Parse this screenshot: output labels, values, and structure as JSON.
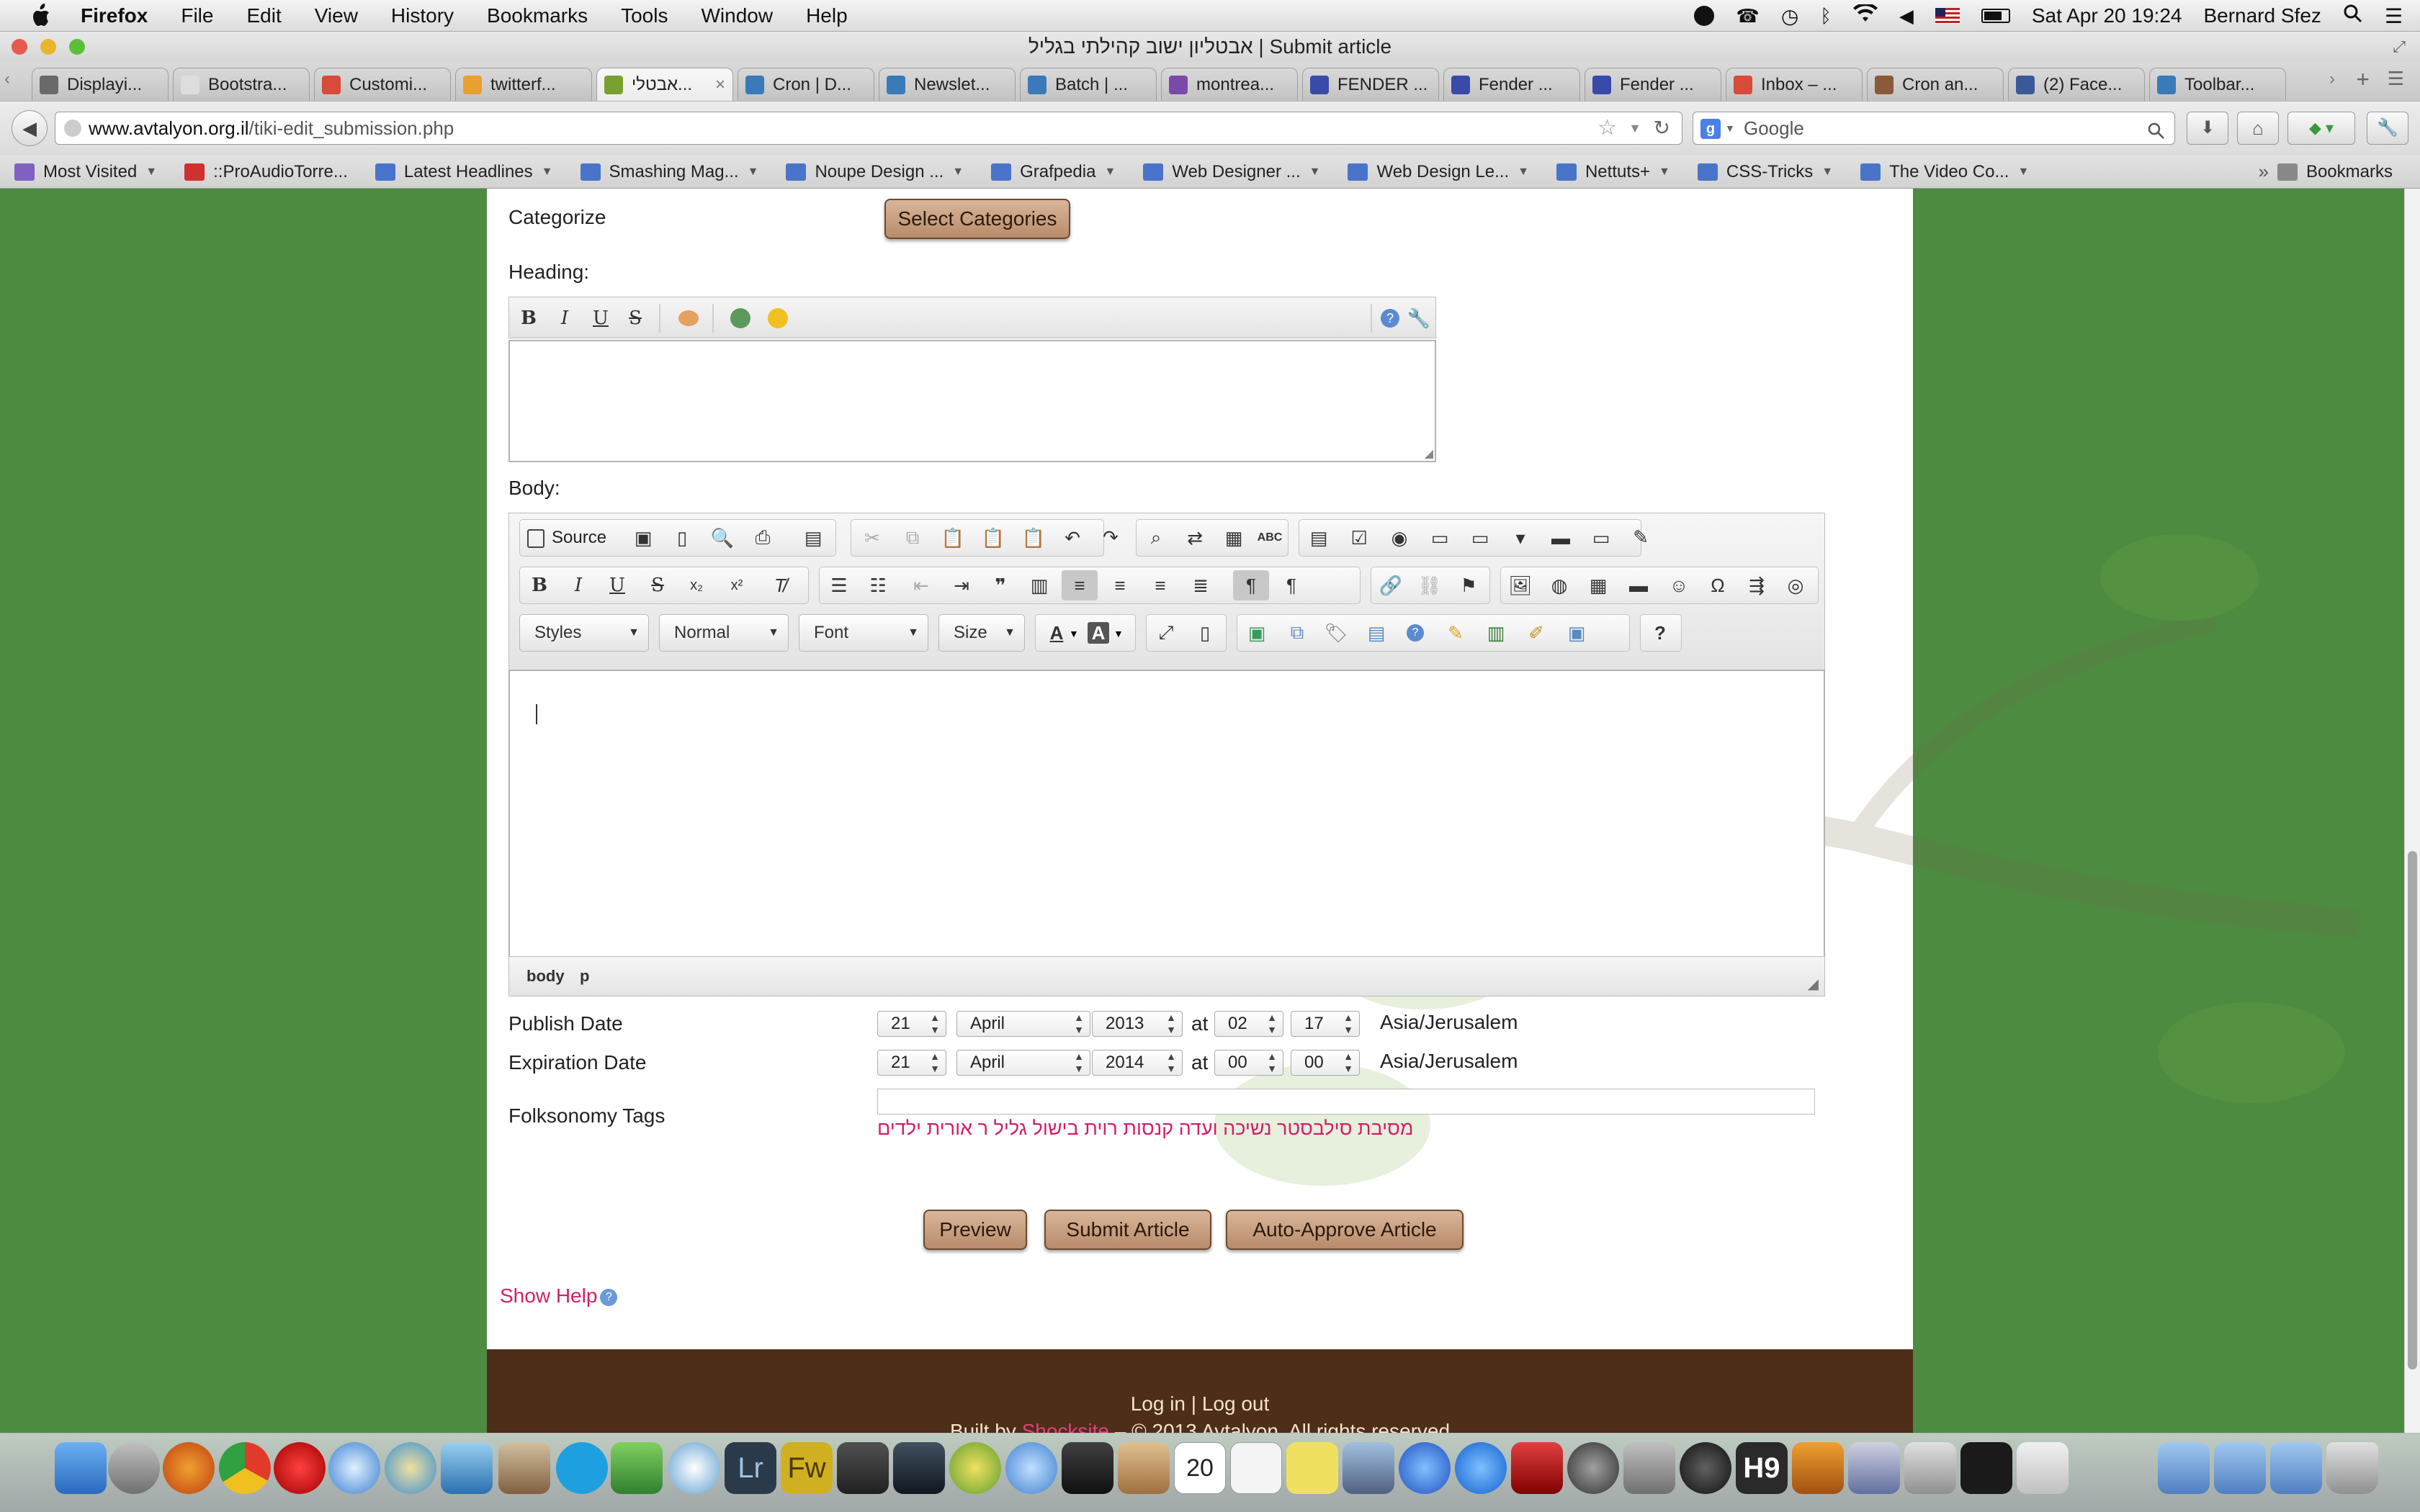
{
  "menubar": {
    "app": "Firefox",
    "items": [
      "File",
      "Edit",
      "View",
      "History",
      "Bookmarks",
      "Tools",
      "Window",
      "Help"
    ],
    "clock": "Sat Apr 20  19:24",
    "user": "Bernard Sfez"
  },
  "window": {
    "title": "אבטליון ישוב קהילתי בגליל | Submit article"
  },
  "tabs": [
    {
      "label": "Displayi...",
      "color": "#6a6a6a"
    },
    {
      "label": "Bootstra...",
      "color": "#dddddd"
    },
    {
      "label": "Customi...",
      "color": "#d84a3a"
    },
    {
      "label": "twitterf...",
      "color": "#e8a030"
    },
    {
      "label": "אבטלי...",
      "color": "#7aa030"
    },
    {
      "label": "Cron | D...",
      "color": "#3a7ab8"
    },
    {
      "label": "Newslet...",
      "color": "#3a7ab8"
    },
    {
      "label": "Batch | ...",
      "color": "#3a7ab8"
    },
    {
      "label": "montrea...",
      "color": "#7a4aa8"
    },
    {
      "label": "FENDER ...",
      "color": "#3a4aa8"
    },
    {
      "label": "Fender ...",
      "color": "#3a4aa8"
    },
    {
      "label": "Fender ...",
      "color": "#3a4aa8"
    },
    {
      "label": "Inbox – ...",
      "color": "#d84a3a"
    },
    {
      "label": "Cron an...",
      "color": "#8a5a3a"
    },
    {
      "label": "(2) Face...",
      "color": "#3b5998"
    },
    {
      "label": "Toolbar...",
      "color": "#3a7ab8"
    }
  ],
  "nav": {
    "url_domain": "www.avtalyon.org.il",
    "url_path": "/tiki-edit_submission.php",
    "search_placeholder": "Google"
  },
  "bookmarks": [
    "Most Visited",
    "::ProAudioTorre...",
    "Latest Headlines",
    "Smashing Mag...",
    "Noupe Design ...",
    "Grafpedia",
    "Web Designer ...",
    "Web Design Le...",
    "Nettuts+",
    "CSS-Tricks",
    "The Video Co...",
    "Bookmarks"
  ],
  "form": {
    "categorize_label": "Categorize",
    "select_categories_button": "Select Categories",
    "heading_label": "Heading:",
    "body_label": "Body:",
    "source_button": "Source",
    "styles_combo": "Styles",
    "format_combo": "Normal",
    "font_combo": "Font",
    "size_combo": "Size",
    "path_body": "body",
    "path_p": "p",
    "publish_label": "Publish Date",
    "expiration_label": "Expiration Date",
    "at": "at",
    "timezone": "Asia/Jerusalem",
    "publish": {
      "day": "21",
      "month": "April",
      "year": "2013",
      "hour": "02",
      "minute": "17"
    },
    "expiration": {
      "day": "21",
      "month": "April",
      "year": "2014",
      "hour": "00",
      "minute": "00"
    },
    "tags_label": "Folksonomy Tags",
    "tags_suggestions": "מסיבת סילבסטר נשיכה ועדה קנסות רוית בישול גליל ר אורית ילדים",
    "preview_button": "Preview",
    "submit_button": "Submit Article",
    "auto_approve_button": "Auto-Approve Article",
    "show_help": "Show Help"
  },
  "footer": {
    "login": "Log in",
    "separator": " | ",
    "logout": "Log out",
    "built_prefix": "Built by ",
    "built_by": "Shocksite",
    "built_suffix": " – © 2013 Avtalyon. All rights reserved"
  },
  "colors": {
    "page_bg": "#4c8b40",
    "link": "#d0206a",
    "wood": "#b88b6a",
    "footer": "#4e2e18"
  }
}
